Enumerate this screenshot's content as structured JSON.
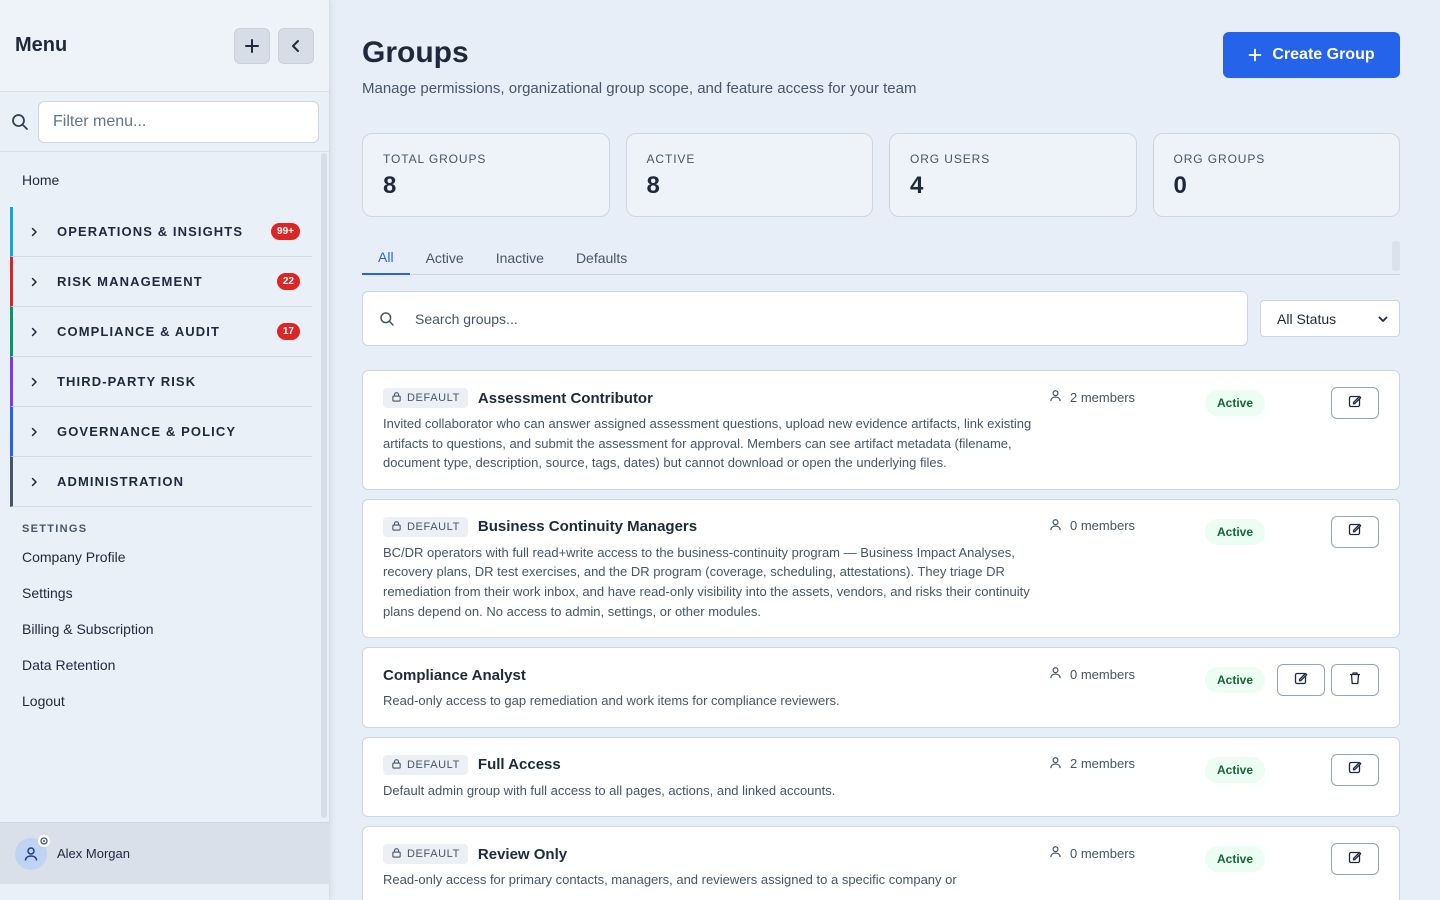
{
  "sidebar": {
    "title": "Menu",
    "add_icon": "plus-icon",
    "collapse_icon": "chevron-left-icon",
    "search_placeholder": "Filter menu...",
    "home": "Home",
    "sections": [
      {
        "label": "OPERATIONS & INSIGHTS",
        "badge": "99+",
        "color": "#0ea5e9"
      },
      {
        "label": "RISK MANAGEMENT",
        "badge": "22",
        "color": "#dc2626"
      },
      {
        "label": "COMPLIANCE & AUDIT",
        "badge": "17",
        "color": "#059669"
      },
      {
        "label": "THIRD-PARTY RISK",
        "badge": "",
        "color": "#7c3aed"
      },
      {
        "label": "GOVERNANCE & POLICY",
        "badge": "",
        "color": "#2563eb"
      },
      {
        "label": "ADMINISTRATION",
        "badge": "",
        "color": "#475569"
      }
    ],
    "settings_heading": "SETTINGS",
    "settings_links": [
      "Company Profile",
      "Settings",
      "Billing & Subscription",
      "Data Retention",
      "Logout"
    ],
    "user_name": "Alex Morgan"
  },
  "header": {
    "title": "Groups",
    "subtitle": "Manage permissions, organizational group scope, and feature access for your team",
    "create_label": "Create Group"
  },
  "stats": [
    {
      "label": "TOTAL GROUPS",
      "value": "8"
    },
    {
      "label": "ACTIVE",
      "value": "8"
    },
    {
      "label": "ORG USERS",
      "value": "4"
    },
    {
      "label": "ORG GROUPS",
      "value": "0"
    }
  ],
  "tabs": [
    "All",
    "Active",
    "Inactive",
    "Defaults"
  ],
  "active_tab": "All",
  "search": {
    "placeholder": "Search groups..."
  },
  "status_filter": {
    "selected": "All Status"
  },
  "default_badge": "DEFAULT",
  "groups": [
    {
      "name": "Assessment Contributor",
      "is_default": true,
      "members": "2 members",
      "status": "Active",
      "deletable": false,
      "description": "Invited collaborator who can answer assigned assessment questions, upload new evidence artifacts, link existing artifacts to questions, and submit the assessment for approval. Members can see artifact metadata (filename, document type, description, source, tags, dates) but cannot download or open the underlying files."
    },
    {
      "name": "Business Continuity Managers",
      "is_default": true,
      "members": "0 members",
      "status": "Active",
      "deletable": false,
      "description": "BC/DR operators with full read+write access to the business-continuity program — Business Impact Analyses, recovery plans, DR test exercises, and the DR program (coverage, scheduling, attestations). They triage DR remediation from their work inbox, and have read-only visibility into the assets, vendors, and risks their continuity plans depend on. No access to admin, settings, or other modules."
    },
    {
      "name": "Compliance Analyst",
      "is_default": false,
      "members": "0 members",
      "status": "Active",
      "deletable": true,
      "description": "Read-only access to gap remediation and work items for compliance reviewers."
    },
    {
      "name": "Full Access",
      "is_default": true,
      "members": "2 members",
      "status": "Active",
      "deletable": false,
      "description": "Default admin group with full access to all pages, actions, and linked accounts."
    },
    {
      "name": "Review Only",
      "is_default": true,
      "members": "0 members",
      "status": "Active",
      "deletable": false,
      "description": "Read-only access for primary contacts, managers, and reviewers assigned to a specific company or"
    }
  ]
}
